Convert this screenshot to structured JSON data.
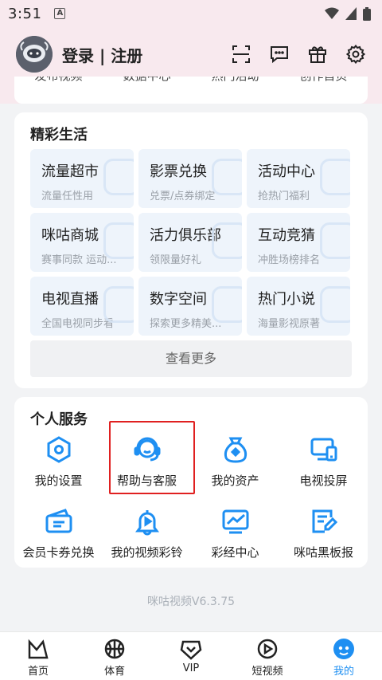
{
  "status_bar": {
    "time": "3:51",
    "badge": "A"
  },
  "header": {
    "login_label": "登录 | 注册"
  },
  "tools_row": [
    "发布视频",
    "数据中心",
    "热门活动",
    "创作首页"
  ],
  "life": {
    "title": "精彩生活",
    "tiles": [
      {
        "title": "流量超市",
        "subtitle": "流量任性用"
      },
      {
        "title": "影票兑换",
        "subtitle": "兑票/点券绑定"
      },
      {
        "title": "活动中心",
        "subtitle": "抢热门福利"
      },
      {
        "title": "咪咕商城",
        "subtitle": "赛事同款 运动..."
      },
      {
        "title": "活力俱乐部",
        "subtitle": "领限量好礼"
      },
      {
        "title": "互动竞猜",
        "subtitle": "冲胜场榜排名"
      },
      {
        "title": "电视直播",
        "subtitle": "全国电视同步看"
      },
      {
        "title": "数字空间",
        "subtitle": "探索更多精美..."
      },
      {
        "title": "热门小说",
        "subtitle": "海量影视原著"
      }
    ],
    "more_label": "查看更多"
  },
  "services": {
    "title": "个人服务",
    "items": [
      {
        "label": "我的设置",
        "icon": "settings-hex-icon"
      },
      {
        "label": "帮助与客服",
        "icon": "customer-service-icon"
      },
      {
        "label": "我的资产",
        "icon": "money-bag-icon"
      },
      {
        "label": "电视投屏",
        "icon": "tv-cast-icon"
      },
      {
        "label": "会员卡券兑换",
        "icon": "coupon-icon"
      },
      {
        "label": "我的视频彩铃",
        "icon": "bell-icon"
      },
      {
        "label": "彩经中心",
        "icon": "chart-icon"
      },
      {
        "label": "咪咕黑板报",
        "icon": "notepad-icon"
      }
    ]
  },
  "version": "咪咕视频V6.3.75",
  "tabs": [
    {
      "label": "首页",
      "icon": "home-icon"
    },
    {
      "label": "体育",
      "icon": "basketball-icon"
    },
    {
      "label": "VIP",
      "icon": "vip-icon"
    },
    {
      "label": "短视频",
      "icon": "play-circle-icon"
    },
    {
      "label": "我的",
      "icon": "mine-icon",
      "active": true
    }
  ],
  "colors": {
    "accent": "#1e8ff2",
    "highlight": "#e02020",
    "top_bg": "#f8e9ee"
  }
}
